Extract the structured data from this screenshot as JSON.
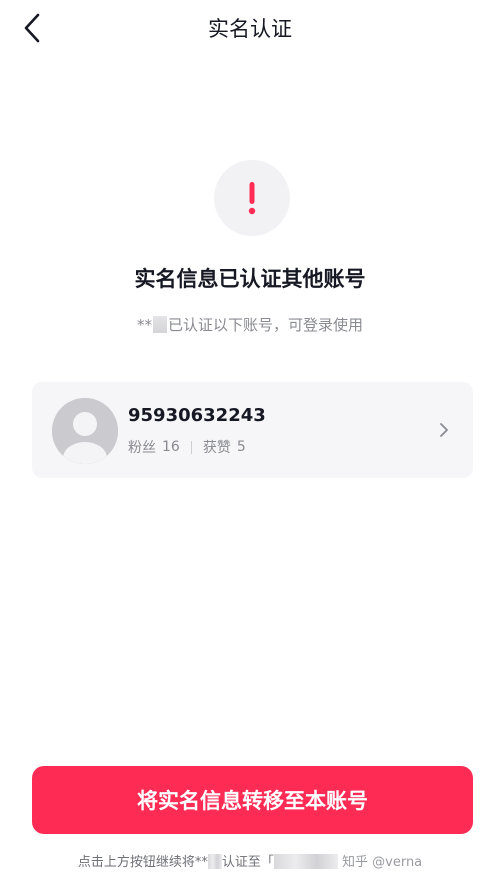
{
  "header": {
    "title": "实名认证",
    "back_icon": "chevron-left-icon"
  },
  "status": {
    "icon": "exclamation-icon",
    "icon_color": "#fe2c55",
    "headline": "实名信息已认证其他账号",
    "subtext_prefix": "**",
    "subtext_suffix": "已认证以下账号，可登录使用"
  },
  "account": {
    "name": "95930632243",
    "fans_label": "粉丝",
    "fans_count": "16",
    "likes_label": "获赞",
    "likes_count": "5"
  },
  "action": {
    "transfer_label": "将实名信息转移至本账号",
    "accent_color": "#fe2c55"
  },
  "footer": {
    "note_part1": "点击上方按钮继续将**",
    "note_part2": "认证至「",
    "watermark": "知乎 @verna"
  }
}
